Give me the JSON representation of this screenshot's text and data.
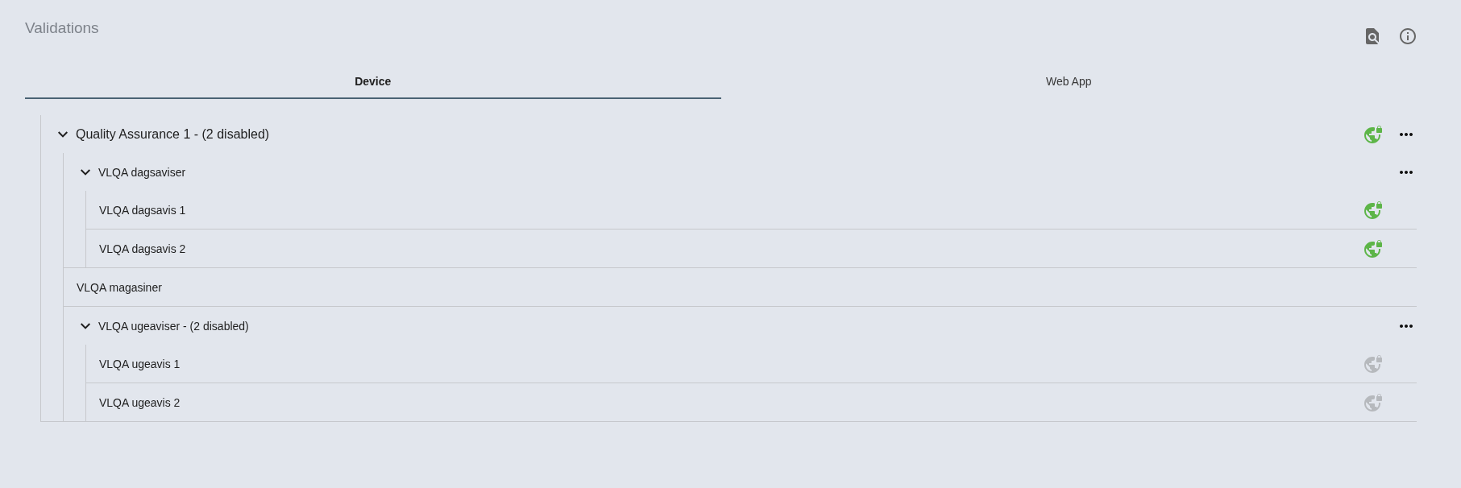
{
  "title": "Validations",
  "tabs": [
    {
      "label": "Device",
      "selected": true
    },
    {
      "label": "Web App",
      "selected": false
    }
  ],
  "tree": [
    {
      "label": "Quality Assurance 1 - (2 disabled)",
      "expanded": true,
      "globe": true,
      "disabled": false,
      "menu": true,
      "children": [
        {
          "label": "VLQA dagsaviser",
          "expanded": true,
          "globe": false,
          "menu": true,
          "children": [
            {
              "label": "VLQA dagsavis 1",
              "globe": true,
              "disabled": false,
              "menu": false
            },
            {
              "label": "VLQA dagsavis 2",
              "globe": true,
              "disabled": false,
              "menu": false
            }
          ]
        },
        {
          "label": "VLQA magasiner",
          "globe": false,
          "menu": false
        },
        {
          "label": "VLQA ugeaviser - (2 disabled)",
          "expanded": true,
          "globe": false,
          "menu": true,
          "children": [
            {
              "label": "VLQA ugeavis 1",
              "globe": true,
              "disabled": true,
              "menu": false
            },
            {
              "label": "VLQA ugeavis 2",
              "globe": true,
              "disabled": true,
              "menu": false
            }
          ]
        }
      ]
    }
  ]
}
